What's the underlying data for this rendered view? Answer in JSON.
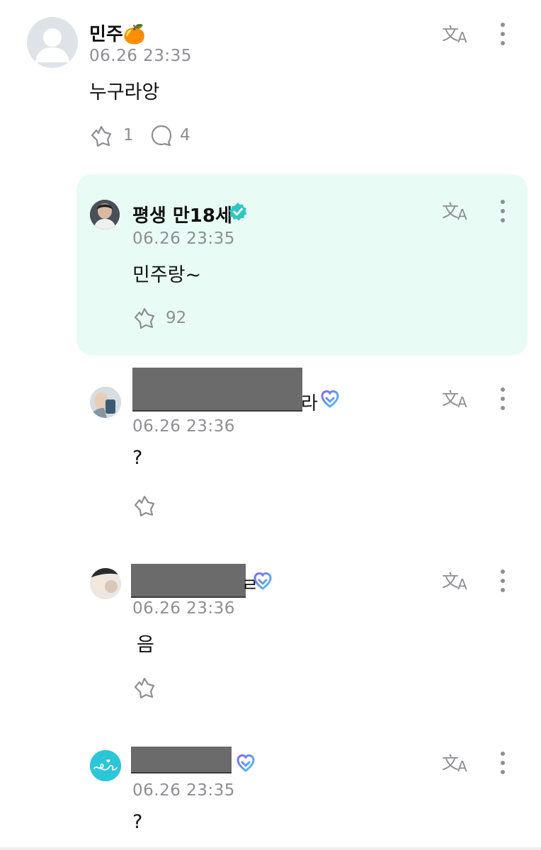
{
  "comment": {
    "author": "민주🍊",
    "time": "06.26 23:35",
    "text": "누구라앙",
    "like_count": "1",
    "reply_count": "4"
  },
  "replies": [
    {
      "author": "평생 만18세",
      "time": "06.26 23:35",
      "text": "민주랑~",
      "like_count": "92",
      "verified": "artist"
    },
    {
      "author_suffix": "라",
      "time": "06.26 23:36",
      "text": "?"
    },
    {
      "author_suffix": "ㄹ",
      "time": "06.26 23:36",
      "text": "음"
    },
    {
      "time": "06.26 23:35",
      "text": "?"
    }
  ],
  "colors": {
    "highlight_bg": "#e9fbf5",
    "verified_teal": "#2fc7c0",
    "meta_gray": "#8e8e93"
  }
}
